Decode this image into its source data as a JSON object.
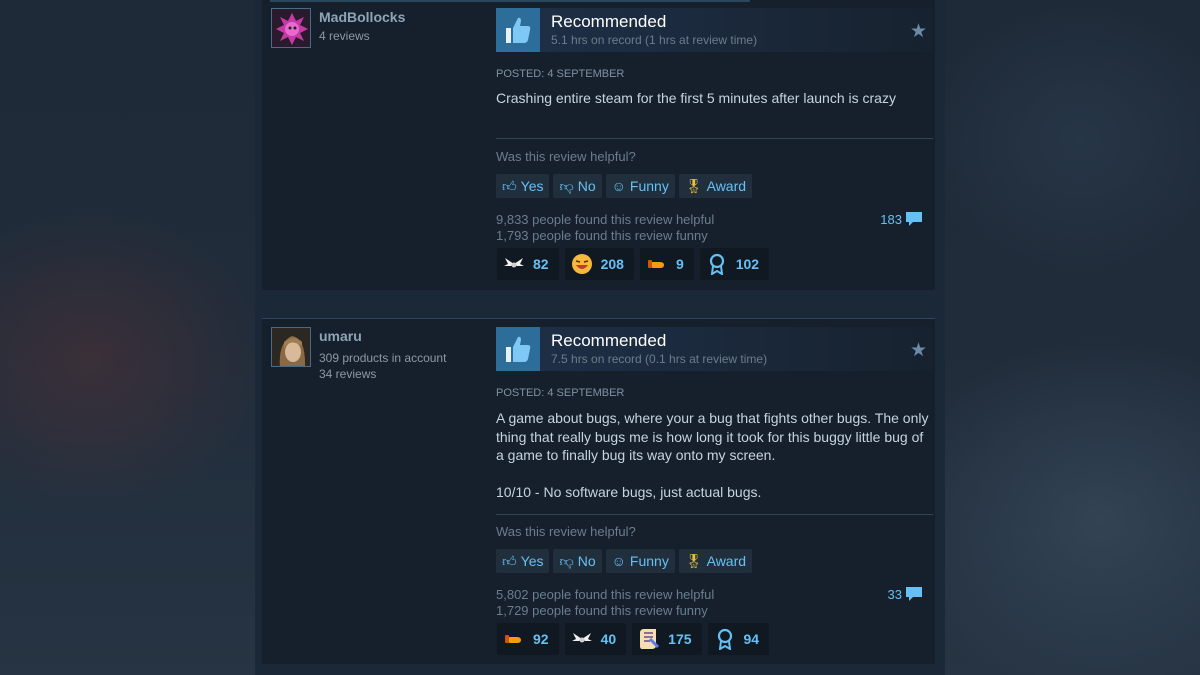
{
  "reviews": [
    {
      "username": "MadBollocks",
      "user_stats": [
        "4 reviews"
      ],
      "verdict": "Recommended",
      "hours": "5.1 hrs on record (1 hrs at review time)",
      "posted": "Posted: 4 September",
      "content": "Crashing entire steam for the first 5 minutes after launch is crazy",
      "helpful_question": "Was this review helpful?",
      "buttons": {
        "yes": "Yes",
        "no": "No",
        "funny": "Funny",
        "award": "Award"
      },
      "helpful_count": "9,833 people found this review helpful",
      "funny_count": "1,793 people found this review funny",
      "comments": "183",
      "awards": [
        {
          "icon": "wings-icon",
          "count": "82"
        },
        {
          "icon": "laughing-face-icon",
          "count": "208"
        },
        {
          "icon": "pointing-hand-icon",
          "count": "9"
        },
        {
          "icon": "ribbon-icon",
          "count": "102"
        }
      ]
    },
    {
      "username": "umaru",
      "user_stats": [
        "309 products in account",
        "34 reviews"
      ],
      "verdict": "Recommended",
      "hours": "7.5 hrs on record (0.1 hrs at review time)",
      "posted": "Posted: 4 September",
      "content": "A game about bugs, where your a bug that fights other bugs. The only thing that really bugs me is how long it took for this buggy little bug of a game to finally bug its way onto my screen.\n\n10/10 - No software bugs, just actual bugs.",
      "helpful_question": "Was this review helpful?",
      "buttons": {
        "yes": "Yes",
        "no": "No",
        "funny": "Funny",
        "award": "Award"
      },
      "helpful_count": "5,802 people found this review helpful",
      "funny_count": "1,729 people found this review funny",
      "comments": "33",
      "awards": [
        {
          "icon": "pointing-hand-icon",
          "count": "92"
        },
        {
          "icon": "wings-icon",
          "count": "40"
        },
        {
          "icon": "scroll-icon",
          "count": "175"
        },
        {
          "icon": "ribbon-icon",
          "count": "94"
        }
      ]
    }
  ],
  "colors": {
    "accent": "#66c0f4",
    "thumb_box": "#2d6d99",
    "panel": "#16202d"
  }
}
